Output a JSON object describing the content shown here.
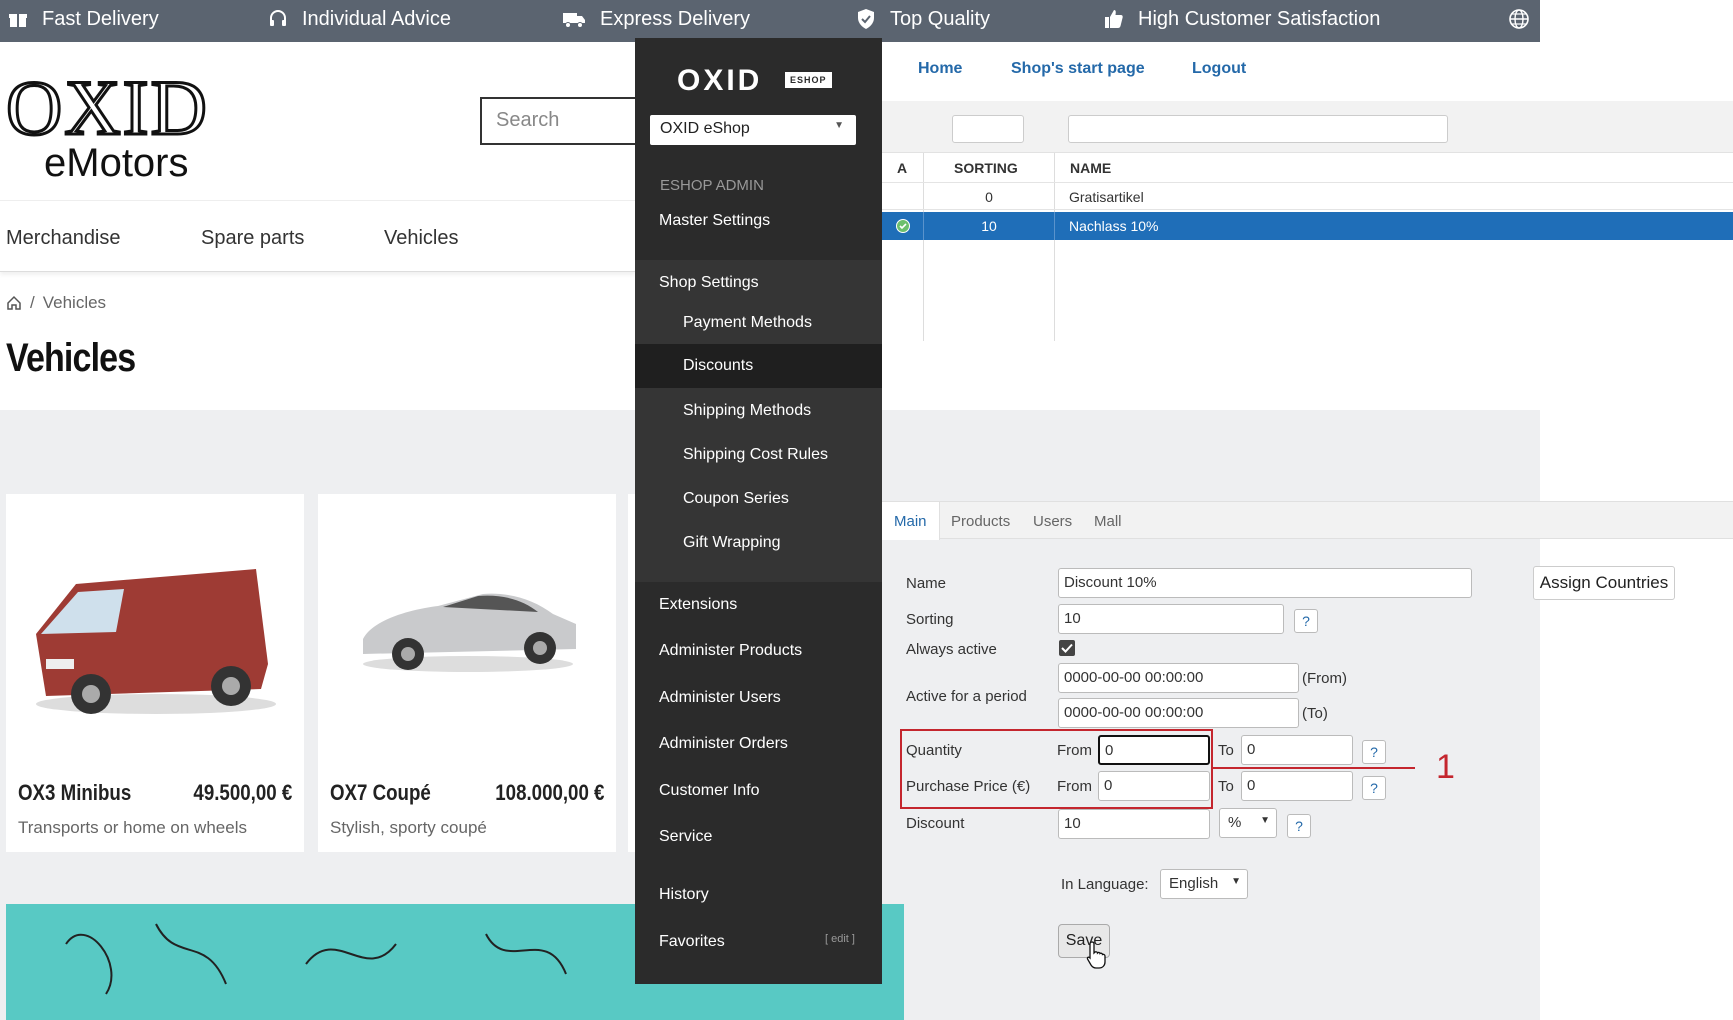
{
  "topbar": {
    "items": [
      {
        "label": "Fast Delivery",
        "icon": "gift-icon"
      },
      {
        "label": "Individual Advice",
        "icon": "headset-icon"
      },
      {
        "label": "Express Delivery",
        "icon": "truck-icon"
      },
      {
        "label": "Top Quality",
        "icon": "shield-check-icon"
      },
      {
        "label": "High Customer Satisfaction",
        "icon": "thumbs-up-icon"
      }
    ],
    "globe_icon": "globe-icon"
  },
  "shop": {
    "logo_line1": "OXID",
    "logo_line2": "eMotors",
    "search_placeholder": "Search",
    "nav": [
      "Merchandise",
      "Spare parts",
      "Vehicles"
    ],
    "breadcrumb": [
      "Vehicles"
    ],
    "page_title": "Vehicles",
    "products": [
      {
        "name": "OX3 Minibus",
        "price": "49.500,00 €",
        "desc": "Transports or home on wheels"
      },
      {
        "name": "OX7 Coupé",
        "price": "108.000,00 €",
        "desc": "Stylish, sporty coupé"
      }
    ]
  },
  "admin": {
    "logo": "OXID",
    "logo_badge": "ESHOP",
    "shop_select": "OXID eShop",
    "section_head": "ESHOP ADMIN",
    "menu": {
      "master_settings": "Master Settings",
      "shop_settings": "Shop Settings",
      "payment_methods": "Payment Methods",
      "discounts": "Discounts",
      "shipping_methods": "Shipping Methods",
      "shipping_cost_rules": "Shipping Cost Rules",
      "coupon_series": "Coupon Series",
      "gift_wrapping": "Gift Wrapping",
      "extensions": "Extensions",
      "administer_products": "Administer Products",
      "administer_users": "Administer Users",
      "administer_orders": "Administer Orders",
      "customer_info": "Customer Info",
      "service": "Service",
      "history": "History",
      "favorites": "Favorites",
      "favorites_edit": "[ edit ]"
    },
    "top_links": {
      "home": "Home",
      "start_page": "Shop's start page",
      "logout": "Logout"
    },
    "list": {
      "columns": {
        "active": "A",
        "sorting": "SORTING",
        "name": "NAME"
      },
      "rows": [
        {
          "sorting": "0",
          "name": "Gratisartikel",
          "active": false,
          "selected": false
        },
        {
          "sorting": "10",
          "name": "Nachlass 10%",
          "active": true,
          "selected": true
        }
      ]
    },
    "tabs": [
      "Main",
      "Products",
      "Users",
      "Mall"
    ],
    "form": {
      "name_label": "Name",
      "name_value": "Discount 10%",
      "assign_countries": "Assign Countries",
      "sorting_label": "Sorting",
      "sorting_value": "10",
      "always_active_label": "Always active",
      "always_active_checked": true,
      "period_label": "Active for a period",
      "period_from": "0000-00-00 00:00:00",
      "period_from_suffix": "(From)",
      "period_to": "0000-00-00 00:00:00",
      "period_to_suffix": "(To)",
      "quantity_label": "Quantity",
      "purchase_label": "Purchase Price (€)",
      "from_label": "From",
      "to_label": "To",
      "quantity_from": "0",
      "quantity_to": "0",
      "price_from": "0",
      "price_to": "0",
      "discount_label": "Discount",
      "discount_value": "10",
      "discount_unit": "%",
      "language_label": "In Language:",
      "language_value": "English",
      "help": "?",
      "save": "Save",
      "callout_number": "1"
    },
    "colors": {
      "link": "#2469a9",
      "selected_row": "#1f6eb8",
      "highlight": "#c4262e"
    }
  }
}
